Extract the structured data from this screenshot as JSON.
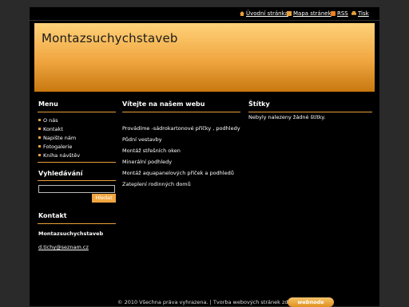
{
  "top_links": [
    {
      "label": "Úvodní stránka",
      "icon": "home-icon"
    },
    {
      "label": "Mapa stránek",
      "icon": "sitemap-icon"
    },
    {
      "label": "RSS",
      "icon": "rss-icon"
    },
    {
      "label": "Tisk",
      "icon": "print-icon"
    }
  ],
  "header": {
    "title": "Montazsuchychstaveb"
  },
  "sidebar": {
    "menu_heading": "Menu",
    "menu_items": [
      {
        "label": "O nás"
      },
      {
        "label": "Kontakt"
      },
      {
        "label": "Napište nám"
      },
      {
        "label": "Fotogalerie"
      },
      {
        "label": "Kniha návštěv"
      }
    ],
    "search_heading": "Vyhledávání",
    "search_value": "",
    "search_button": "Hledat",
    "contact_heading": "Kontakt",
    "contact_name": "Montazsuchychstaveb",
    "contact_email": "d.tichy@seznam.cz"
  },
  "main": {
    "heading": "Vítejte na našem webu",
    "services": [
      "Provádíme -sádrokartonové příčky , podhledy",
      "Půdní vestavby",
      "Montáž střešních oken",
      "Minerální podhledy",
      "Montáž aquapanelových příček a podhledů",
      "Zateplení rodinných domů"
    ]
  },
  "tags": {
    "heading": "Štítky",
    "empty_text": "Nebyly nalezeny žádné štítky."
  },
  "footer": {
    "text": "© 2010 Všechna práva vyhrazena. | Tvorba webových stránek zdarma",
    "badge": "webnode"
  },
  "colors": {
    "accent": "#e8a03a",
    "background": "#000000"
  }
}
